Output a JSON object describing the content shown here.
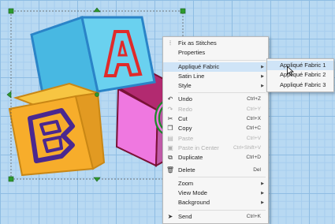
{
  "context_menu": {
    "items": [
      {
        "label": "Fix as Stitches",
        "shortcut": "",
        "icon": "stitches-icon",
        "disabled": false
      },
      {
        "label": "Properties",
        "shortcut": "",
        "icon": "",
        "disabled": false
      },
      {
        "label": "Appliqué Fabric",
        "shortcut": "",
        "icon": "",
        "disabled": false,
        "highlighted": true
      },
      {
        "label": "Satin Line",
        "shortcut": "",
        "icon": "",
        "disabled": false
      },
      {
        "label": "Style",
        "shortcut": "",
        "icon": "",
        "disabled": false
      },
      {
        "label": "Undo",
        "shortcut": "Ctrl+Z",
        "icon": "undo-icon",
        "disabled": false
      },
      {
        "label": "Redo",
        "shortcut": "Ctrl+Y",
        "icon": "redo-icon",
        "disabled": true
      },
      {
        "label": "Cut",
        "shortcut": "Ctrl+X",
        "icon": "scissors-icon",
        "disabled": false
      },
      {
        "label": "Copy",
        "shortcut": "Ctrl+C",
        "icon": "copy-icon",
        "disabled": false
      },
      {
        "label": "Paste",
        "shortcut": "Ctrl+V",
        "icon": "paste-icon",
        "disabled": true
      },
      {
        "label": "Paste in Center",
        "shortcut": "Ctrl+Shift+V",
        "icon": "paste-center-icon",
        "disabled": true
      },
      {
        "label": "Duplicate",
        "shortcut": "Ctrl+D",
        "icon": "duplicate-icon",
        "disabled": false
      },
      {
        "label": "Delete",
        "shortcut": "Del",
        "icon": "trash-icon",
        "disabled": false
      },
      {
        "label": "Zoom",
        "shortcut": "",
        "icon": "",
        "disabled": false
      },
      {
        "label": "View Mode",
        "shortcut": "",
        "icon": "",
        "disabled": false
      },
      {
        "label": "Background",
        "shortcut": "",
        "icon": "",
        "disabled": false
      },
      {
        "label": "Send",
        "shortcut": "Ctrl+K",
        "icon": "send-icon",
        "disabled": false
      }
    ]
  },
  "submenu": {
    "items": [
      {
        "label": "Appliqué Fabric 1",
        "highlighted": true
      },
      {
        "label": "Appliqué Fabric 2",
        "highlighted": false
      },
      {
        "label": "Appliqué Fabric 3",
        "highlighted": false
      }
    ]
  },
  "design": {
    "block_letters": [
      "A",
      "B",
      "C"
    ],
    "colors": {
      "cyan_block": "#6ad1ef",
      "pink_block": "#ef78e0",
      "orange_block": "#f7ad2b",
      "maroon_border": "#7a1236",
      "red_letter": "#e02a2a",
      "purple_letter": "#4a2890",
      "green_letter": "#1e8a2a",
      "selection_handle": "#2e9a2e"
    }
  }
}
